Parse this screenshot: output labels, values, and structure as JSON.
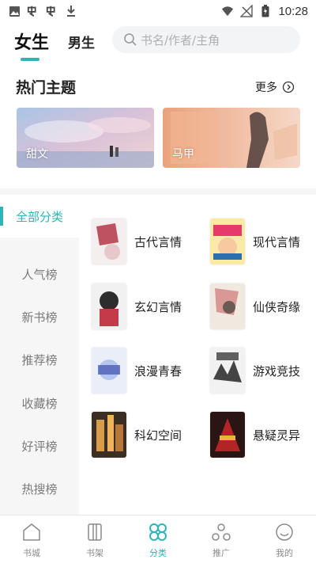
{
  "status_bar": {
    "time": "10:28"
  },
  "header": {
    "tabs": [
      {
        "label": "女生"
      },
      {
        "label": "男生"
      }
    ],
    "search_placeholder": "书名/作者/主角"
  },
  "hot_topics": {
    "title": "热门主题",
    "more_label": "更多",
    "cards": [
      {
        "label": "甜文"
      },
      {
        "label": "马甲"
      }
    ]
  },
  "sidebar": {
    "items": [
      {
        "label": "全部分类",
        "active": true
      },
      {
        "label": "人气榜"
      },
      {
        "label": "新书榜"
      },
      {
        "label": "推荐榜"
      },
      {
        "label": "收藏榜"
      },
      {
        "label": "好评榜"
      },
      {
        "label": "热搜榜"
      }
    ]
  },
  "categories": [
    {
      "label": "古代言情"
    },
    {
      "label": "现代言情"
    },
    {
      "label": "玄幻言情"
    },
    {
      "label": "仙侠奇缘"
    },
    {
      "label": "浪漫青春"
    },
    {
      "label": "游戏竞技"
    },
    {
      "label": "科幻空间"
    },
    {
      "label": "悬疑灵异"
    }
  ],
  "bottom_nav": {
    "items": [
      {
        "label": "书城"
      },
      {
        "label": "书架"
      },
      {
        "label": "分类",
        "active": true
      },
      {
        "label": "推广"
      },
      {
        "label": "我的"
      }
    ]
  },
  "colors": {
    "accent": "#2fb3b6",
    "sidebar_bg": "#f6f6f6",
    "text_muted": "#7a7a7a"
  }
}
